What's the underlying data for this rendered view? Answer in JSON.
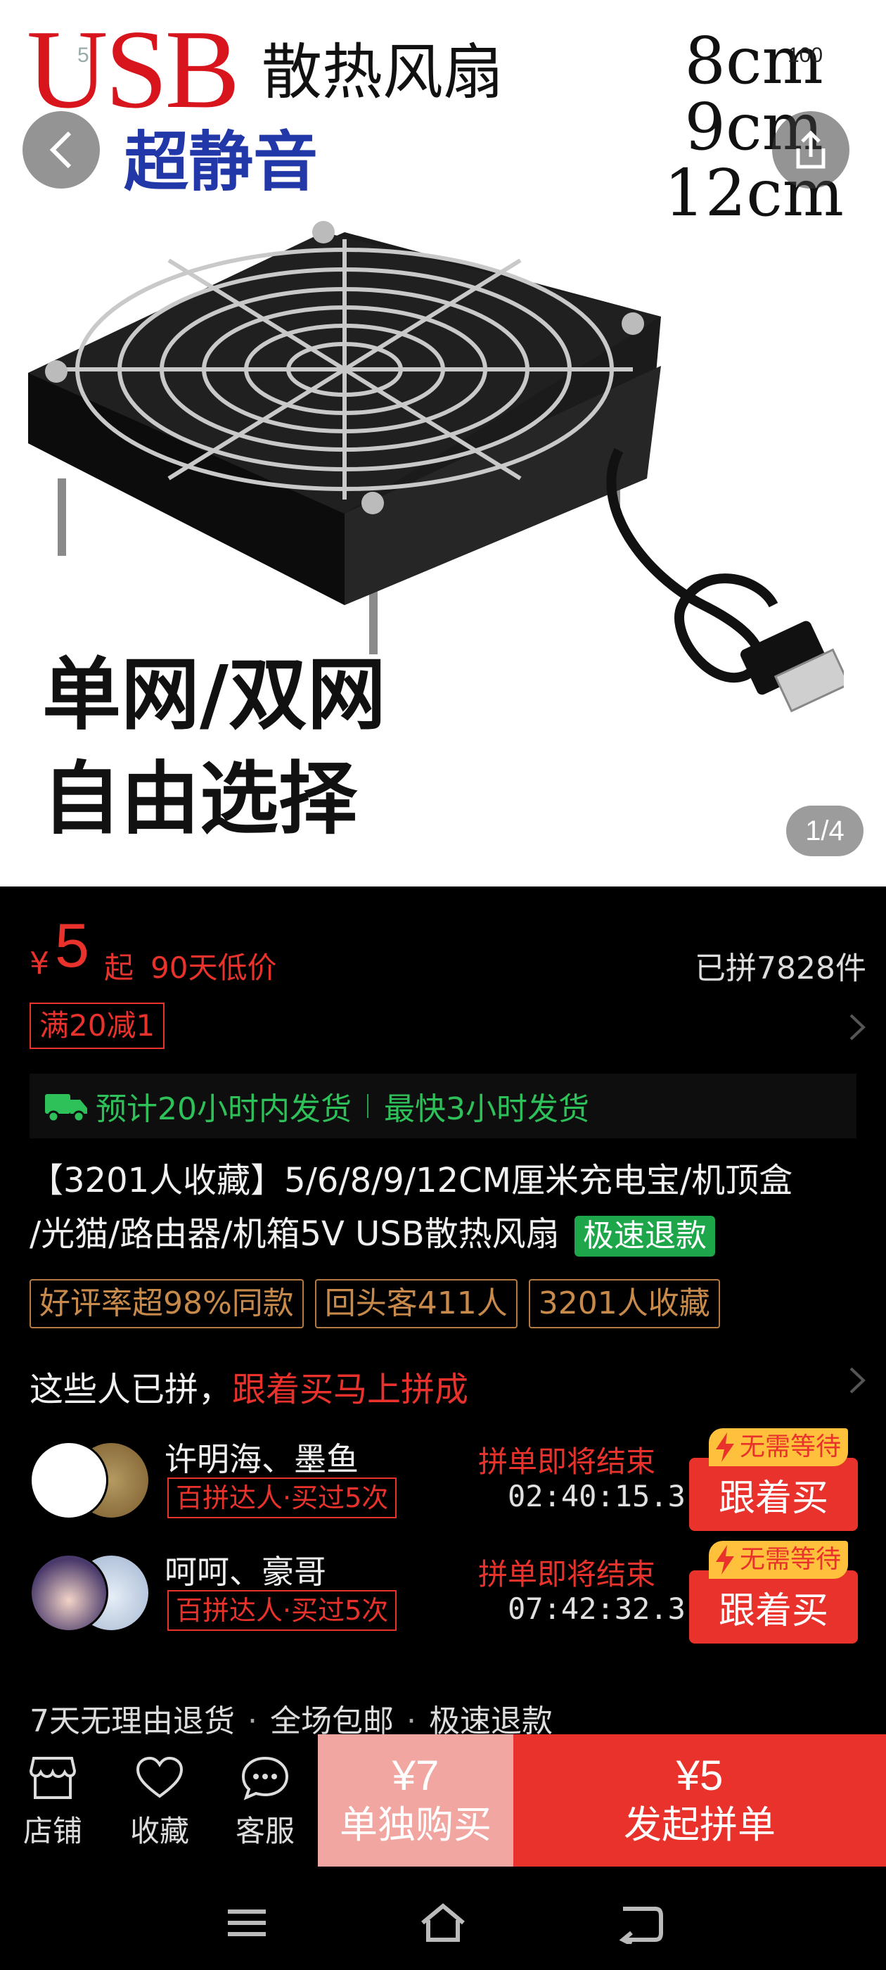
{
  "status_bar": {
    "left_mark": "5",
    "right_number": "100"
  },
  "hero": {
    "title_usb": "USB",
    "title_fan": "散热风扇",
    "title_quiet": "超静音",
    "sizes": [
      "8cm",
      "9cm",
      "12cm"
    ],
    "bottom_lines": [
      "单网/双网",
      "自由选择"
    ],
    "page_indicator": "1/4"
  },
  "price": {
    "currency": "¥",
    "value": "5",
    "suffix": "起",
    "low_price_label": "90天低价",
    "sold": "已拼7828件"
  },
  "coupon": "满20减1",
  "shipping": {
    "estimate": "预计20小时内发货",
    "fastest": "最快3小时发货"
  },
  "product": {
    "title_line1": "【3201人收藏】5/6/8/9/12CM厘米充电宝/机顶盒",
    "title_line2": "/光猫/路由器/机箱5V USB散热风扇",
    "fast_refund_badge": "极速退款"
  },
  "tags": [
    "好评率超98%同款",
    "回头客411人",
    "3201人收藏"
  ],
  "joined": {
    "prefix": "这些人已拼，",
    "highlight": "跟着买马上拼成"
  },
  "groups": [
    {
      "names": "许明海、墨鱼",
      "badge": "百拼达人·买过5次",
      "ending": "拼单即将结束",
      "timer": "02:40:15.3",
      "no_wait": "无需等待",
      "button": "跟着买"
    },
    {
      "names": "呵呵、豪哥",
      "badge": "百拼达人·买过5次",
      "ending": "拼单即将结束",
      "timer": "07:42:32.3",
      "no_wait": "无需等待",
      "button": "跟着买"
    }
  ],
  "services": [
    "7天无理由退货",
    "全场包邮",
    "极速退款"
  ],
  "services_sep": "·",
  "bottom_nav": {
    "store": "店铺",
    "favorite": "收藏",
    "service": "客服",
    "single_price": "¥7",
    "single_label": "单独购买",
    "group_price": "¥5",
    "group_label": "发起拼单"
  },
  "colors": {
    "accent_red": "#e8322b",
    "green": "#2ec15a",
    "tag_brown": "#c88a4a",
    "coupon_yellow": "#ffc13b"
  }
}
